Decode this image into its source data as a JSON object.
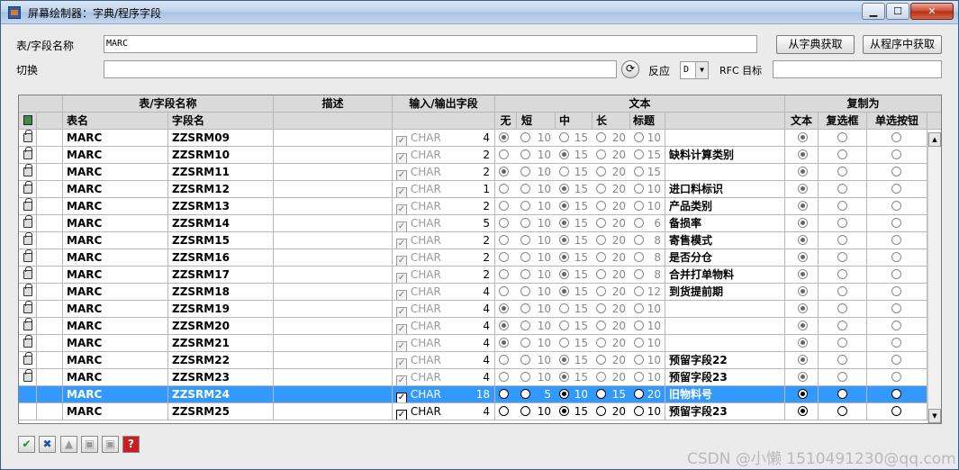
{
  "window": {
    "title": "屏幕绘制器：字典/程序字段"
  },
  "form": {
    "table_field_label": "表/字段名称",
    "table_field_value": "MARC",
    "from_dict_button": "从字典获取",
    "from_program_button": "从程序中获取",
    "switch_label": "切换",
    "switch_value": "",
    "react_label": "反应",
    "react_value": "D",
    "rfc_label": "RFC 目标",
    "rfc_value": ""
  },
  "grid": {
    "group_headers": [
      "表/字段名称",
      "描述",
      "输入/输出字段",
      "文本",
      "复制为"
    ],
    "col_headers": {
      "table": "表名",
      "field": "字段名",
      "none": "无",
      "short": "短",
      "mid": "中",
      "long": "长",
      "title": "标题",
      "as_text": "文本",
      "as_checkbox": "复选框",
      "as_radio": "单选按钮"
    },
    "rows": [
      {
        "table": "MARC",
        "field": "ZZSRM09",
        "type": "CHAR",
        "len": "4",
        "text_sel": 0,
        "lens": [
          "",
          "10",
          "15",
          "20",
          "10"
        ],
        "text": "",
        "copy_sel": 0,
        "locked": true,
        "selected": false,
        "active": false
      },
      {
        "table": "MARC",
        "field": "ZZSRM10",
        "type": "CHAR",
        "len": "2",
        "text_sel": 2,
        "lens": [
          "",
          "10",
          "15",
          "20",
          "15"
        ],
        "text": "缺料计算类别",
        "copy_sel": 0,
        "locked": true,
        "selected": false,
        "active": false
      },
      {
        "table": "MARC",
        "field": "ZZSRM11",
        "type": "CHAR",
        "len": "2",
        "text_sel": 0,
        "lens": [
          "",
          "10",
          "15",
          "20",
          "15"
        ],
        "text": "",
        "copy_sel": 0,
        "locked": true,
        "selected": false,
        "active": false
      },
      {
        "table": "MARC",
        "field": "ZZSRM12",
        "type": "CHAR",
        "len": "1",
        "text_sel": 2,
        "lens": [
          "",
          "10",
          "15",
          "20",
          "10"
        ],
        "text": "进口料标识",
        "copy_sel": 0,
        "locked": true,
        "selected": false,
        "active": false
      },
      {
        "table": "MARC",
        "field": "ZZSRM13",
        "type": "CHAR",
        "len": "2",
        "text_sel": 2,
        "lens": [
          "",
          "10",
          "15",
          "20",
          "10"
        ],
        "text": "产品类别",
        "copy_sel": 0,
        "locked": true,
        "selected": false,
        "active": false
      },
      {
        "table": "MARC",
        "field": "ZZSRM14",
        "type": "CHAR",
        "len": "5",
        "text_sel": 2,
        "lens": [
          "",
          "10",
          "15",
          "20",
          "6"
        ],
        "text": "备损率",
        "copy_sel": 0,
        "locked": true,
        "selected": false,
        "active": false
      },
      {
        "table": "MARC",
        "field": "ZZSRM15",
        "type": "CHAR",
        "len": "2",
        "text_sel": 2,
        "lens": [
          "",
          "10",
          "15",
          "20",
          "8"
        ],
        "text": "寄售模式",
        "copy_sel": 0,
        "locked": true,
        "selected": false,
        "active": false
      },
      {
        "table": "MARC",
        "field": "ZZSRM16",
        "type": "CHAR",
        "len": "2",
        "text_sel": 2,
        "lens": [
          "",
          "10",
          "15",
          "20",
          "8"
        ],
        "text": "是否分仓",
        "copy_sel": 0,
        "locked": true,
        "selected": false,
        "active": false
      },
      {
        "table": "MARC",
        "field": "ZZSRM17",
        "type": "CHAR",
        "len": "2",
        "text_sel": 2,
        "lens": [
          "",
          "10",
          "15",
          "20",
          "8"
        ],
        "text": "合并打单物料",
        "copy_sel": 0,
        "locked": true,
        "selected": false,
        "active": false
      },
      {
        "table": "MARC",
        "field": "ZZSRM18",
        "type": "CHAR",
        "len": "4",
        "text_sel": 2,
        "lens": [
          "",
          "10",
          "15",
          "20",
          "12"
        ],
        "text": "到货提前期",
        "copy_sel": 0,
        "locked": true,
        "selected": false,
        "active": false
      },
      {
        "table": "MARC",
        "field": "ZZSRM19",
        "type": "CHAR",
        "len": "4",
        "text_sel": 0,
        "lens": [
          "",
          "10",
          "15",
          "20",
          "10"
        ],
        "text": "",
        "copy_sel": 0,
        "locked": true,
        "selected": false,
        "active": false
      },
      {
        "table": "MARC",
        "field": "ZZSRM20",
        "type": "CHAR",
        "len": "4",
        "text_sel": 0,
        "lens": [
          "",
          "10",
          "15",
          "20",
          "10"
        ],
        "text": "",
        "copy_sel": 0,
        "locked": true,
        "selected": false,
        "active": false
      },
      {
        "table": "MARC",
        "field": "ZZSRM21",
        "type": "CHAR",
        "len": "4",
        "text_sel": 0,
        "lens": [
          "",
          "10",
          "15",
          "20",
          "10"
        ],
        "text": "",
        "copy_sel": 0,
        "locked": true,
        "selected": false,
        "active": false
      },
      {
        "table": "MARC",
        "field": "ZZSRM22",
        "type": "CHAR",
        "len": "4",
        "text_sel": 2,
        "lens": [
          "",
          "10",
          "15",
          "20",
          "10"
        ],
        "text": "预留字段22",
        "copy_sel": 0,
        "locked": true,
        "selected": false,
        "active": false
      },
      {
        "table": "MARC",
        "field": "ZZSRM23",
        "type": "CHAR",
        "len": "4",
        "text_sel": 2,
        "lens": [
          "",
          "10",
          "15",
          "20",
          "10"
        ],
        "text": "预留字段23",
        "copy_sel": 0,
        "locked": true,
        "selected": false,
        "active": false
      },
      {
        "table": "MARC",
        "field": "ZZSRM24",
        "type": "CHAR",
        "len": "18",
        "text_sel": 2,
        "lens": [
          "",
          "5",
          "10",
          "15",
          "20"
        ],
        "text": "旧物料号",
        "copy_sel": 0,
        "locked": false,
        "selected": true,
        "active": true
      },
      {
        "table": "MARC",
        "field": "ZZSRM25",
        "type": "CHAR",
        "len": "4",
        "text_sel": 2,
        "lens": [
          "",
          "10",
          "15",
          "20",
          "10"
        ],
        "text": "预留字段23",
        "copy_sel": 0,
        "locked": false,
        "selected": false,
        "active": true
      }
    ]
  },
  "toolbar": [
    "check-icon",
    "cancel-icon",
    "print-icon",
    "save-icon",
    "save-as-icon",
    "help-icon"
  ],
  "watermark": "CSDN @小懒 1510491230@qq.com"
}
